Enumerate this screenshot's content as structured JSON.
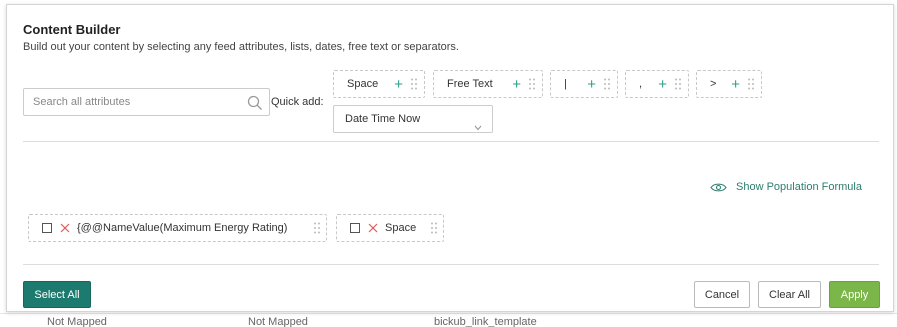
{
  "background_rows": [
    "Not Mapped",
    "Not Mapped",
    "bickub_link_template"
  ],
  "dialog": {
    "title": "Content Builder",
    "subtitle": "Build out your content by selecting any feed attributes, lists, dates, free text or separators."
  },
  "search": {
    "placeholder": "Search all attributes"
  },
  "quick_add": {
    "label": "Quick add:",
    "chips": [
      "Space",
      "Free Text",
      "|",
      ",",
      ">"
    ],
    "date_select": "Date Time Now"
  },
  "formula_link": "Show Population Formula",
  "tokens": [
    "{@@NameValue(Maximum Energy Rating)",
    "Space"
  ],
  "buttons": {
    "select_all": "Select All",
    "cancel": "Cancel",
    "clear_all": "Clear All",
    "apply": "Apply"
  },
  "colors": {
    "accent": "#1d7a6e",
    "apply": "#7ab648",
    "link": "#2e7d6e",
    "remove": "#e05a5a"
  }
}
